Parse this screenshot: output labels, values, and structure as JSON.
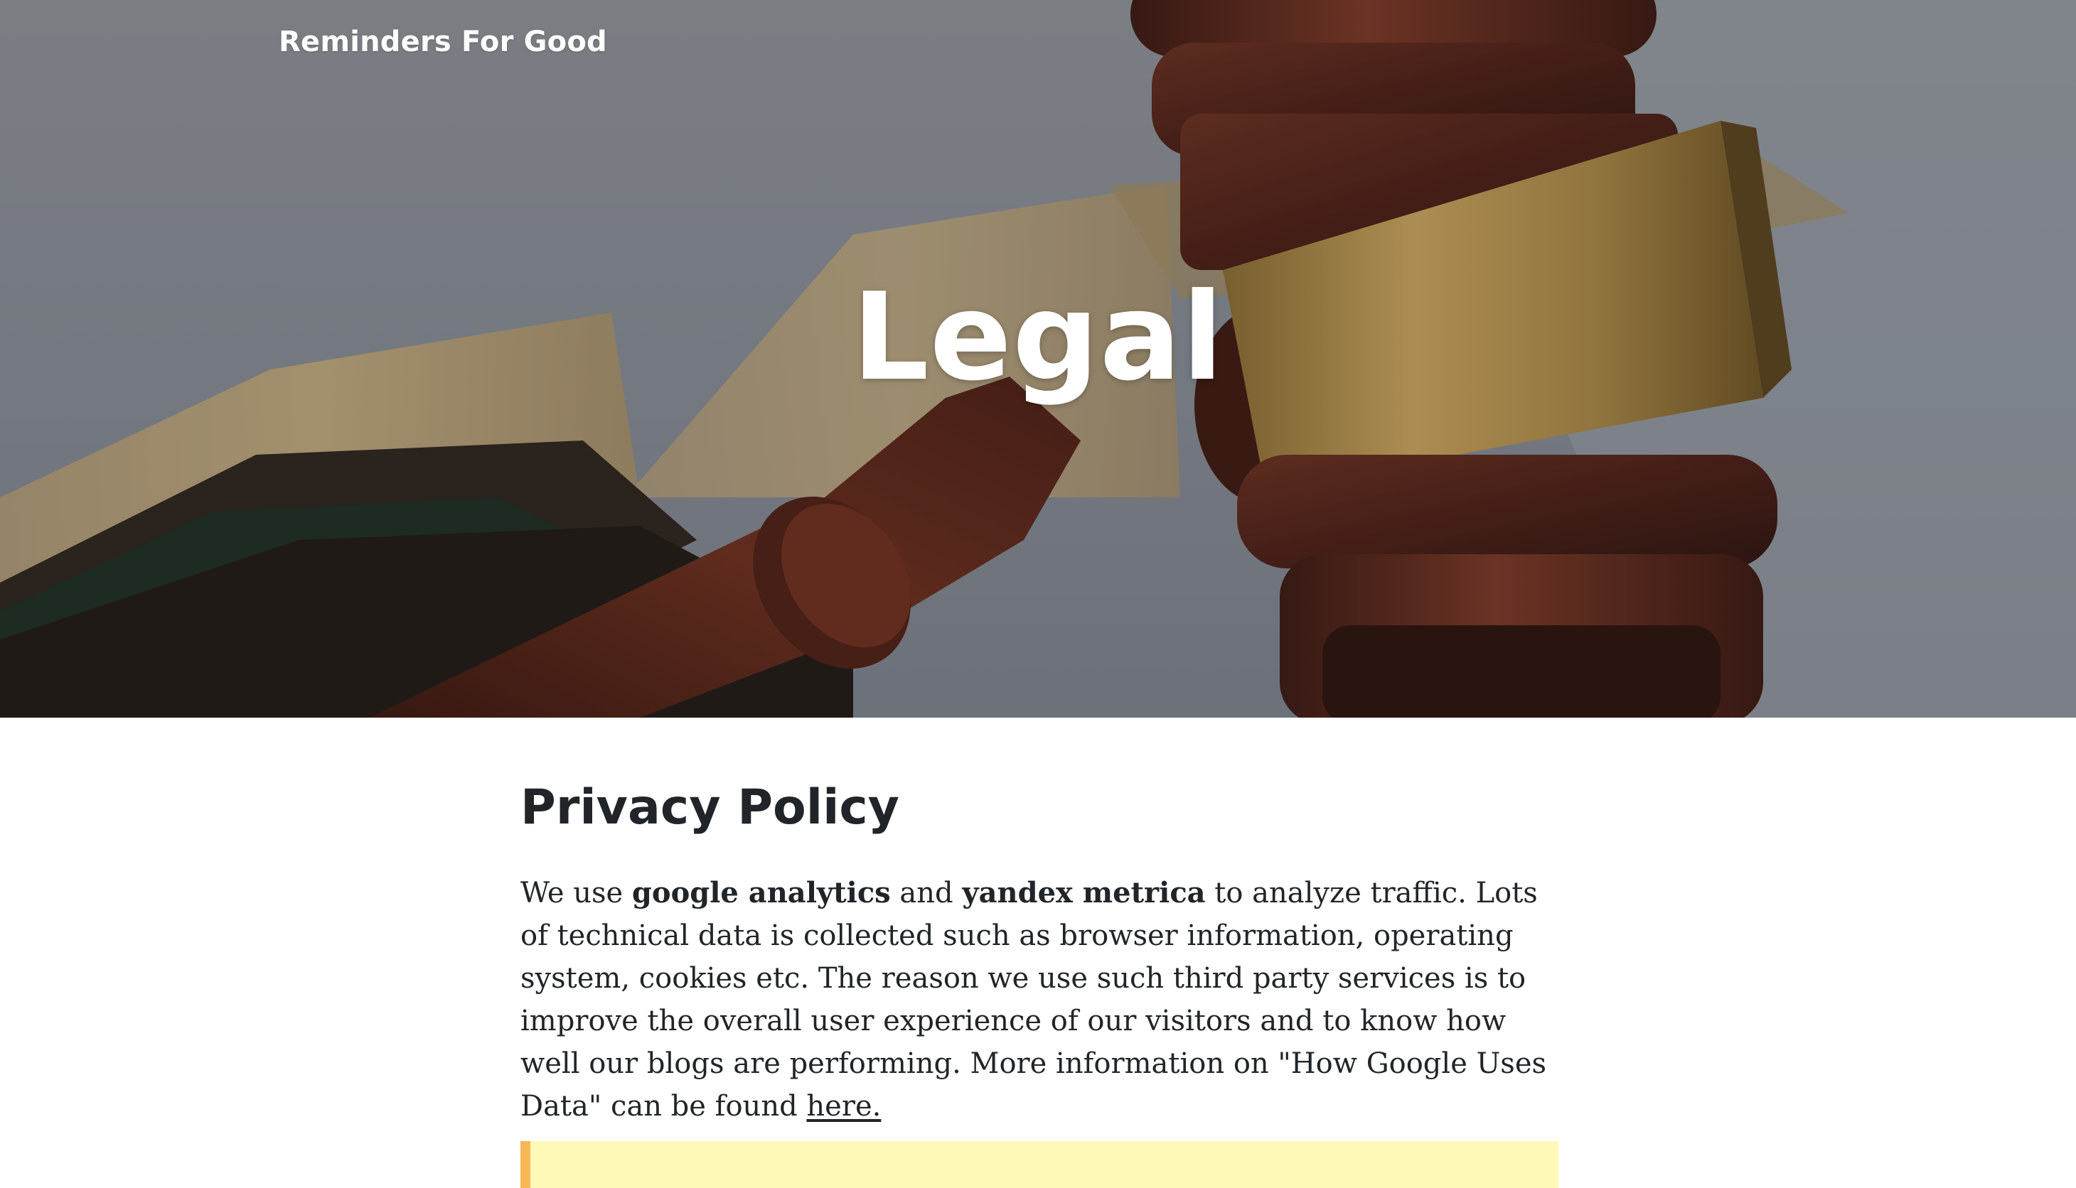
{
  "site": {
    "brand": "Reminders For Good"
  },
  "hero": {
    "title": "Legal",
    "background": "gavel-and-open-book-photo"
  },
  "privacy": {
    "heading": "Privacy Policy",
    "p1_text_1": "We use ",
    "p1_bold_1": "google analytics",
    "p1_text_2": " and ",
    "p1_bold_2": "yandex metrica",
    "p1_text_3": " to analyze traffic. Lots of technical data is collected such as browser information, operating system, cookies etc. The reason we use such third party services is to improve the overall user experience of our visitors and to know how well our blogs are performing. More information on \"How Google Uses Data\" can be found ",
    "p1_link": "here."
  },
  "colors": {
    "callout_background": "#fff9b8",
    "callout_border": "#f7b756",
    "text": "#212529"
  }
}
